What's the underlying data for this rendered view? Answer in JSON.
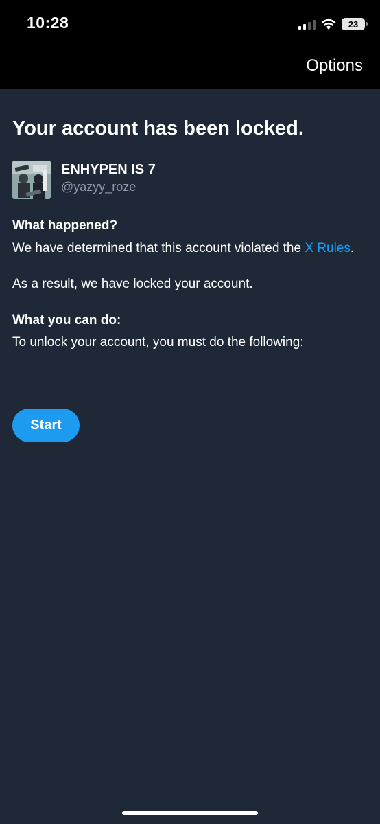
{
  "status_bar": {
    "time": "10:28",
    "battery": "23"
  },
  "header": {
    "options_label": "Options"
  },
  "main": {
    "title": "Your account has been locked.",
    "account": {
      "display_name": "ENHYPEN IS 7",
      "handle": "@yazyy_roze",
      "avatar_icon": "profile-photo"
    },
    "what_happened": {
      "heading": "What happened?",
      "text_before_link": "We have determined that this account violated the ",
      "link_text": "X Rules",
      "text_after_link": "."
    },
    "result_text": "As a result, we have locked your account.",
    "what_you_can_do": {
      "heading": "What you can do:",
      "text": "To unlock your account, you must do the following:"
    },
    "start_button": "Start"
  },
  "colors": {
    "background": "#1e2836",
    "top_bar": "#000000",
    "accent": "#1d9bf0",
    "secondary_text": "#8b98a5"
  }
}
